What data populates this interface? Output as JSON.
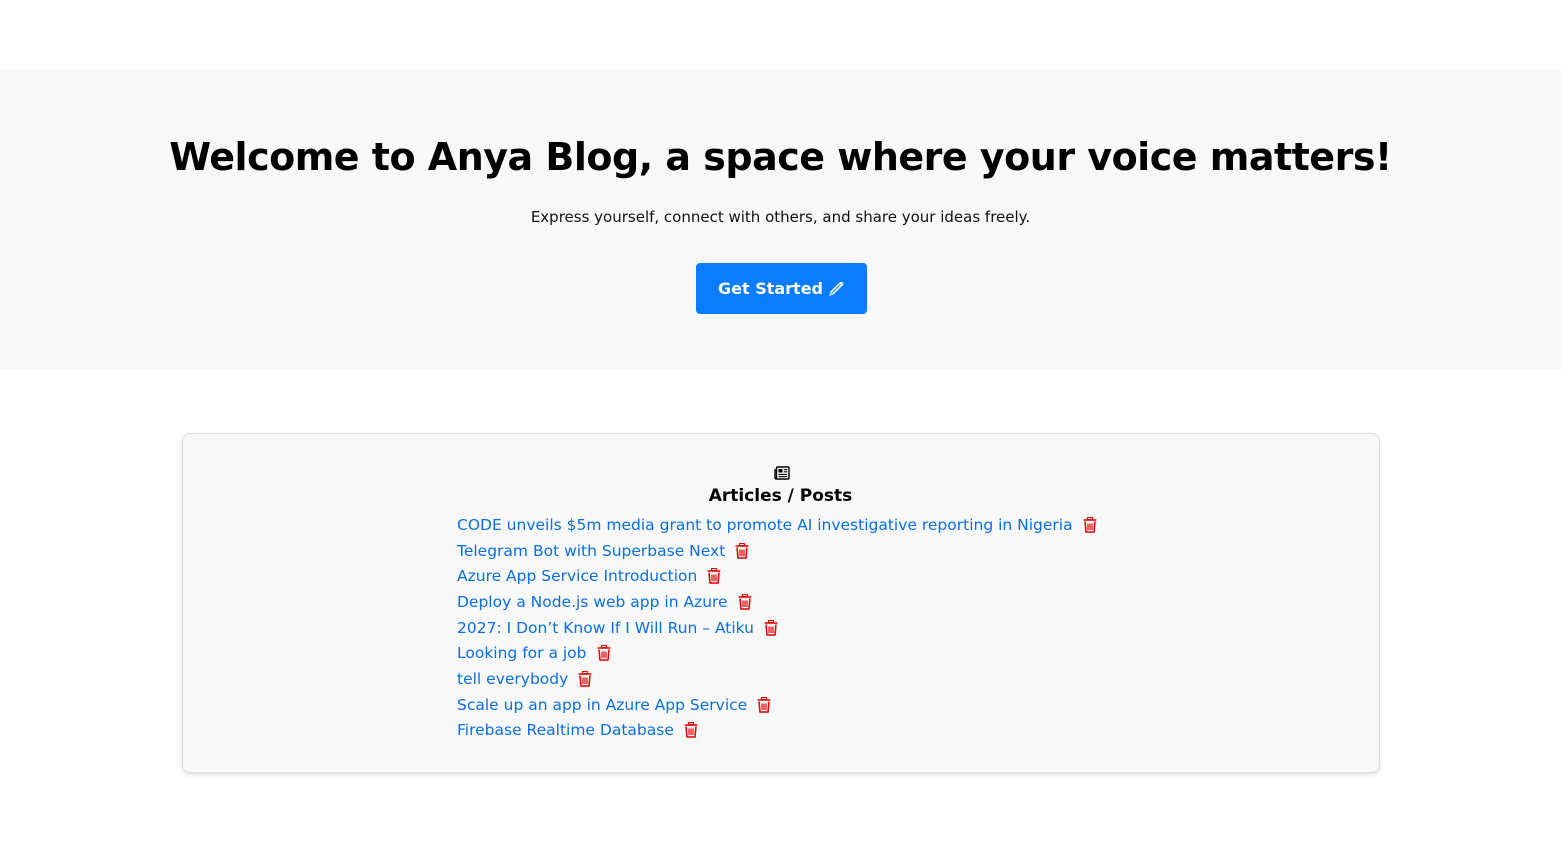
{
  "hero": {
    "title": "Welcome to Anya Blog, a space where your voice matters!",
    "subtitle": "Express yourself, connect with others, and share your ideas freely.",
    "cta_label": "Get Started",
    "cta_icon": "pen-icon"
  },
  "articles": {
    "icon": "newspaper-icon",
    "heading": "Articles / Posts",
    "delete_icon": "trash-icon",
    "delete_color": "#e00000",
    "link_color": "#0a6fe0",
    "items": [
      {
        "title": "CODE unveils $5m media grant to promote AI investigative reporting in Nigeria"
      },
      {
        "title": "Telegram Bot with Superbase Next"
      },
      {
        "title": "Azure App Service Introduction"
      },
      {
        "title": "Deploy a Node.js web app in Azure"
      },
      {
        "title": "2027: I Don’t Know If I Will Run – Atiku"
      },
      {
        "title": "Looking for a job"
      },
      {
        "title": "tell everybody"
      },
      {
        "title": "Scale up an app in Azure App Service"
      },
      {
        "title": "Firebase Realtime Database"
      }
    ]
  },
  "colors": {
    "accent": "#0a7cff",
    "hero_background": "#f8f8f8"
  }
}
